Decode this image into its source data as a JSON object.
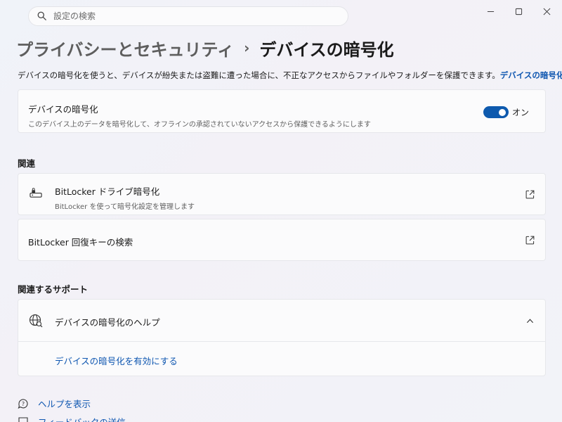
{
  "search": {
    "placeholder": "設定の検索"
  },
  "breadcrumb": {
    "parent": "プライバシーとセキュリティ",
    "separator": "›",
    "current": "デバイスの暗号化"
  },
  "description": {
    "text": "デバイスの暗号化を使うと、デバイスが紛失または盗難に遭った場合に、不正なアクセスからファイルやフォルダーを保護できます。",
    "link": "デバイスの暗号化の詳細"
  },
  "device_encryption": {
    "title": "デバイスの暗号化",
    "subtitle": "このデバイス上のデータを暗号化して、オフラインの承認されていないアクセスから保護できるようにします",
    "toggle_label": "オン",
    "toggle_on": true
  },
  "related": {
    "heading": "関連",
    "bitlocker": {
      "title": "BitLocker ドライブ暗号化",
      "subtitle": "BitLocker を使って暗号化設定を管理します"
    },
    "recovery": {
      "title": "BitLocker 回復キーの検索"
    }
  },
  "support": {
    "heading": "関連するサポート",
    "help_title": "デバイスの暗号化のヘルプ",
    "help_link": "デバイスの暗号化を有効にする"
  },
  "footer": {
    "get_help": "ヘルプを表示",
    "feedback": "フィードバックの送信"
  },
  "colors": {
    "accent": "#0e5aae",
    "link": "#0e56b0"
  }
}
